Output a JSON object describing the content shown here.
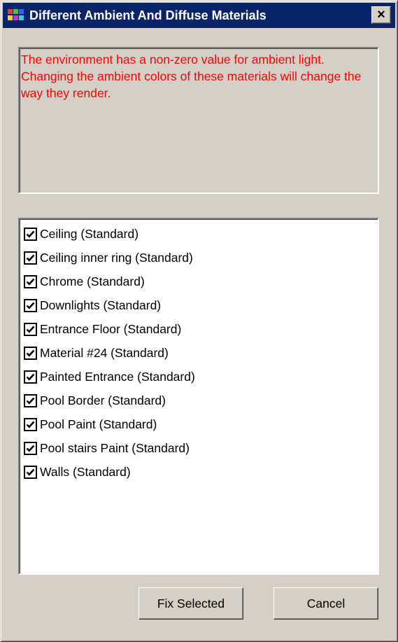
{
  "window": {
    "title": "Different Ambient And Diffuse Materials",
    "close_label": "×",
    "app_icon": "colorful-app-icon"
  },
  "message": {
    "text": "The environment has a non-zero value for ambient light. Changing the ambient colors of these materials will change the way they render.",
    "color": "#ff0000"
  },
  "materials": [
    {
      "label": "Ceiling (Standard)",
      "checked": true
    },
    {
      "label": "Ceiling inner ring (Standard)",
      "checked": true
    },
    {
      "label": "Chrome (Standard)",
      "checked": true
    },
    {
      "label": "Downlights (Standard)",
      "checked": true
    },
    {
      "label": "Entrance Floor (Standard)",
      "checked": true
    },
    {
      "label": "Material #24 (Standard)",
      "checked": true
    },
    {
      "label": "Painted Entrance (Standard)",
      "checked": true
    },
    {
      "label": "Pool Border (Standard)",
      "checked": true
    },
    {
      "label": "Pool Paint (Standard)",
      "checked": true
    },
    {
      "label": "Pool stairs Paint (Standard)",
      "checked": true
    },
    {
      "label": "Walls (Standard)",
      "checked": true
    }
  ],
  "buttons": {
    "fix_selected": "Fix Selected",
    "cancel": "Cancel"
  },
  "colors": {
    "titlebar": "#0a246a",
    "face": "#d4d0c8"
  }
}
